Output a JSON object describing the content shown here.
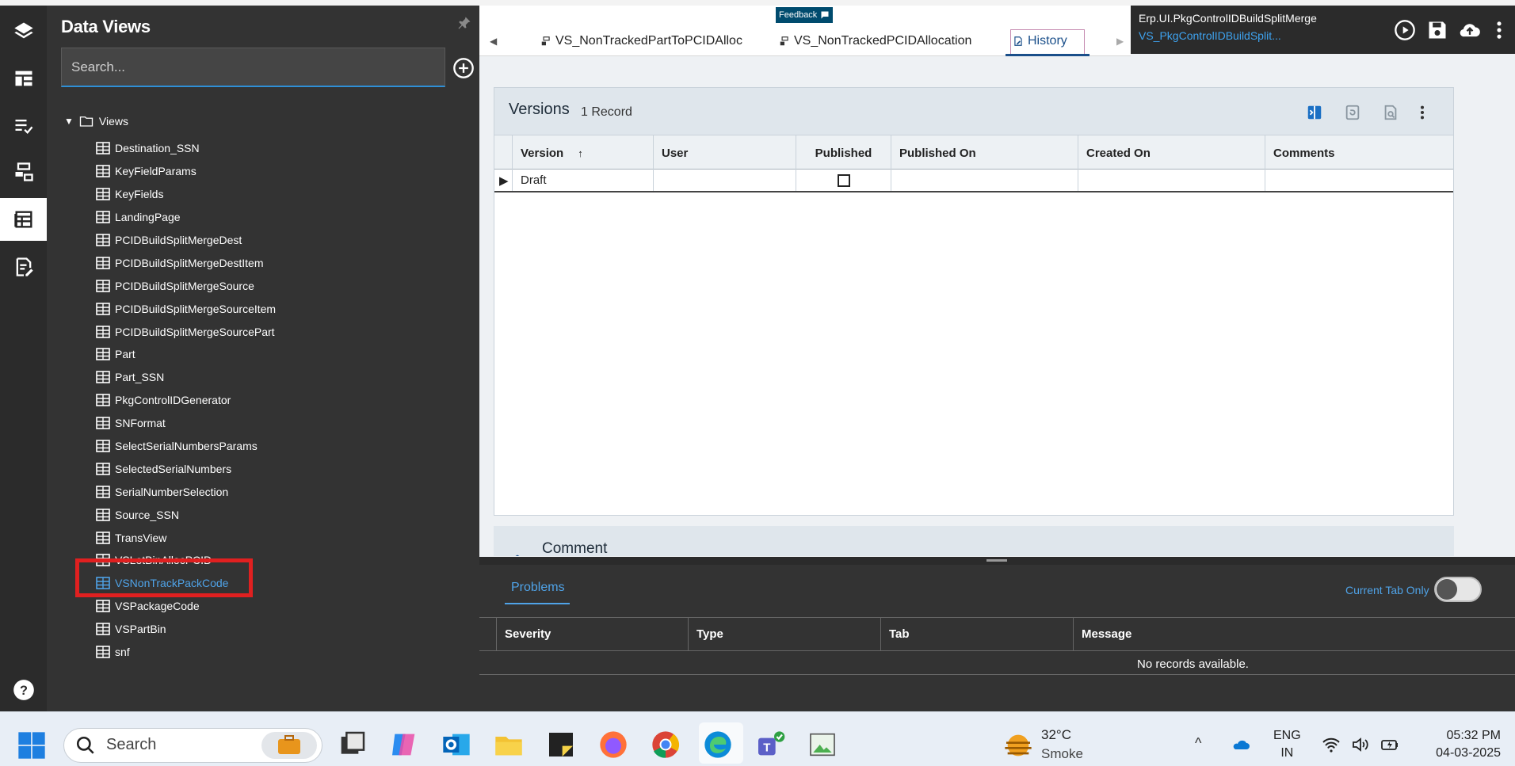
{
  "panel": {
    "title": "Data Views",
    "search_placeholder": "Search...",
    "root_label": "Views",
    "items": [
      "Destination_SSN",
      "KeyFieldParams",
      "KeyFields",
      "LandingPage",
      "PCIDBuildSplitMergeDest",
      "PCIDBuildSplitMergeDestItem",
      "PCIDBuildSplitMergeSource",
      "PCIDBuildSplitMergeSourceItem",
      "PCIDBuildSplitMergeSourcePart",
      "Part",
      "Part_SSN",
      "PkgControlIDGenerator",
      "SNFormat",
      "SelectSerialNumbersParams",
      "SelectedSerialNumbers",
      "SerialNumberSelection",
      "Source_SSN",
      "TransView",
      "VSLotBinAllocPCID",
      "VSNonTrackPackCode",
      "VSPackageCode",
      "VSPartBin",
      "snf"
    ],
    "selected_item": "VSNonTrackPackCode"
  },
  "tabs": {
    "items": [
      {
        "label": "VS_NonTrackedPartToPCIDAlloc"
      },
      {
        "label": "VS_NonTrackedPCIDAllocation"
      },
      {
        "label": "History"
      }
    ],
    "active": "History",
    "feedback_label": "Feedback"
  },
  "header": {
    "title": "Erp.UI.PkgControlIDBuildSplitMerge",
    "subtitle": "VS_PkgControlIDBuildSplit..."
  },
  "versions": {
    "title": "Versions",
    "count": "1 Record",
    "columns": [
      "Version",
      "User",
      "Published",
      "Published On",
      "Created On",
      "Comments"
    ],
    "rows": [
      {
        "version": "Draft",
        "user": "",
        "published": false,
        "published_on": "",
        "created_on": "",
        "comments": ""
      }
    ]
  },
  "comment": {
    "label": "Comment"
  },
  "problems": {
    "tab_label": "Problems",
    "current_tab_only_label": "Current Tab Only",
    "current_tab_only": false,
    "columns": [
      "Severity",
      "Type",
      "Tab",
      "Message"
    ],
    "empty_text": "No records available."
  },
  "taskbar": {
    "search_label": "Search",
    "weather_temp": "32°C",
    "weather_desc": "Smoke",
    "lang_1": "ENG",
    "lang_2": "IN",
    "time": "05:32 PM",
    "date": "04-03-2025"
  },
  "colors": {
    "accent_blue": "#4fa3e8",
    "dark_panel": "#333333",
    "highlight_red": "#e02020",
    "active_tab": "#1a4f8a"
  }
}
